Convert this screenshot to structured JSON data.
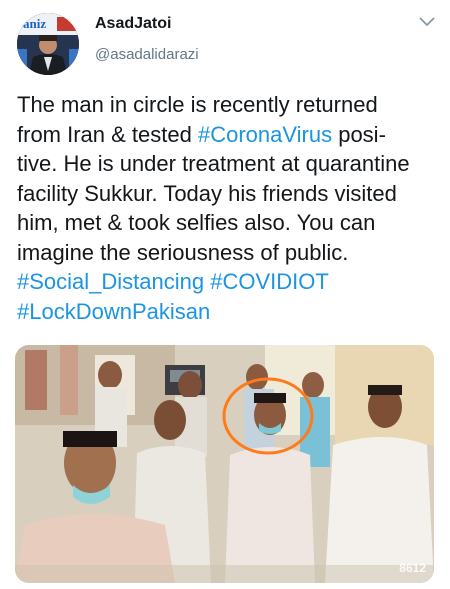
{
  "user": {
    "display_name": "AsadJatoi",
    "handle": "@asadalidarazi",
    "avatar_text": "aniz"
  },
  "tweet": {
    "text_lines": [
      "The man in circle is recently returned",
      "from Iran & tested ",
      " posi-",
      "tive. He is under treatment at quarantine",
      "facility Sukkur. Today his friends visited",
      "him, met & took selfies also. You can",
      "imagine the seriousness of public."
    ],
    "hashtags": [
      "#CoronaVirus",
      "#Social_Distancing",
      "#COVIDIOT",
      "#LockDownPakisan"
    ]
  },
  "media": {
    "watermark": "8612",
    "description_icon": "photo-icon"
  },
  "colors": {
    "hashtag": "#1b95e0",
    "secondary_text": "#657786",
    "circle": "#ff7a1a"
  }
}
